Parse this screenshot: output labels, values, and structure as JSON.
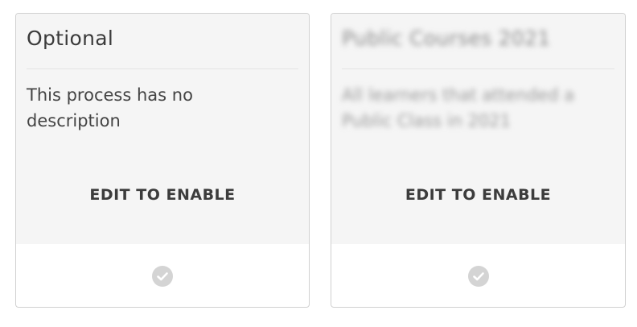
{
  "cards": [
    {
      "title": "Optional",
      "description": "This process has no description",
      "action_label": "EDIT TO ENABLE",
      "status_icon": "check-circle-icon"
    },
    {
      "title": "Public Courses 2021",
      "description": "All learners that attended a Public Class in 2021",
      "action_label": "EDIT TO ENABLE",
      "status_icon": "check-circle-icon"
    }
  ],
  "colors": {
    "card_background": "#f5f5f5",
    "card_border": "#d0d0d0",
    "check_icon": "#d4d4d4"
  }
}
